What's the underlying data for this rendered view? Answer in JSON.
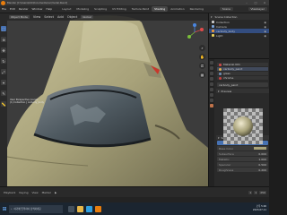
{
  "window": {
    "title": "Blender [C:\\Users\\kim\\Documents\\car\\model.blend]"
  },
  "menus": [
    "File",
    "Edit",
    "Render",
    "Window",
    "Help"
  ],
  "workspace_tabs": [
    "Layout",
    "Modeling",
    "Sculpting",
    "UV Editing",
    "Texture Paint",
    "Shading",
    "Animation",
    "Rendering"
  ],
  "active_tab_index": 5,
  "scene_name": "Scene",
  "view_layer_name": "ViewLayer",
  "viewport": {
    "header": {
      "mode": "Object Mode",
      "menus": [
        "View",
        "Select",
        "Add",
        "Object"
      ],
      "orientation": "Global"
    },
    "info": {
      "line1": "User Perspective (Local)",
      "line2": "(1) Collection | carbody_body"
    }
  },
  "outliner": {
    "header_label": "Scene Collection",
    "rows": [
      {
        "label": "Collection",
        "selected": false
      },
      {
        "label": "Camera",
        "selected": false
      },
      {
        "label": "carbody_body",
        "selected": true
      },
      {
        "label": "Light",
        "selected": false
      }
    ]
  },
  "properties": {
    "slots": [
      {
        "label": "Material.001",
        "color": "#d14a4a",
        "selected": false
      },
      {
        "label": "carbody_paint",
        "color": "#e0b050",
        "selected": true
      },
      {
        "label": "glass",
        "color": "#6f8fb7",
        "selected": false
      },
      {
        "label": "chrome",
        "color": "#c84040",
        "selected": false
      }
    ],
    "material_name": "carbody_paint",
    "preview_section": "Preview",
    "surface_section": "Surface",
    "surface_shader": "Principled BSDF",
    "fields": [
      {
        "label": "Base Color",
        "value": ""
      },
      {
        "label": "Subsurface",
        "value": "0.000"
      },
      {
        "label": "Metallic",
        "value": "1.000"
      },
      {
        "label": "Specular",
        "value": "0.500"
      },
      {
        "label": "Roughness",
        "value": "0.200"
      }
    ]
  },
  "timeline": {
    "items": [
      "Playback",
      "Keying",
      "View",
      "Marker"
    ],
    "start": "1",
    "end": "250",
    "current": "1"
  },
  "taskbar": {
    "search_placeholder": "여기에 입력하여 검색하세요",
    "time": "오후 5:00",
    "date": "2023-07-11"
  },
  "colors": {
    "accent": "#4772b3",
    "active_tab": "#474747",
    "car_paint": "#a8a27a"
  }
}
